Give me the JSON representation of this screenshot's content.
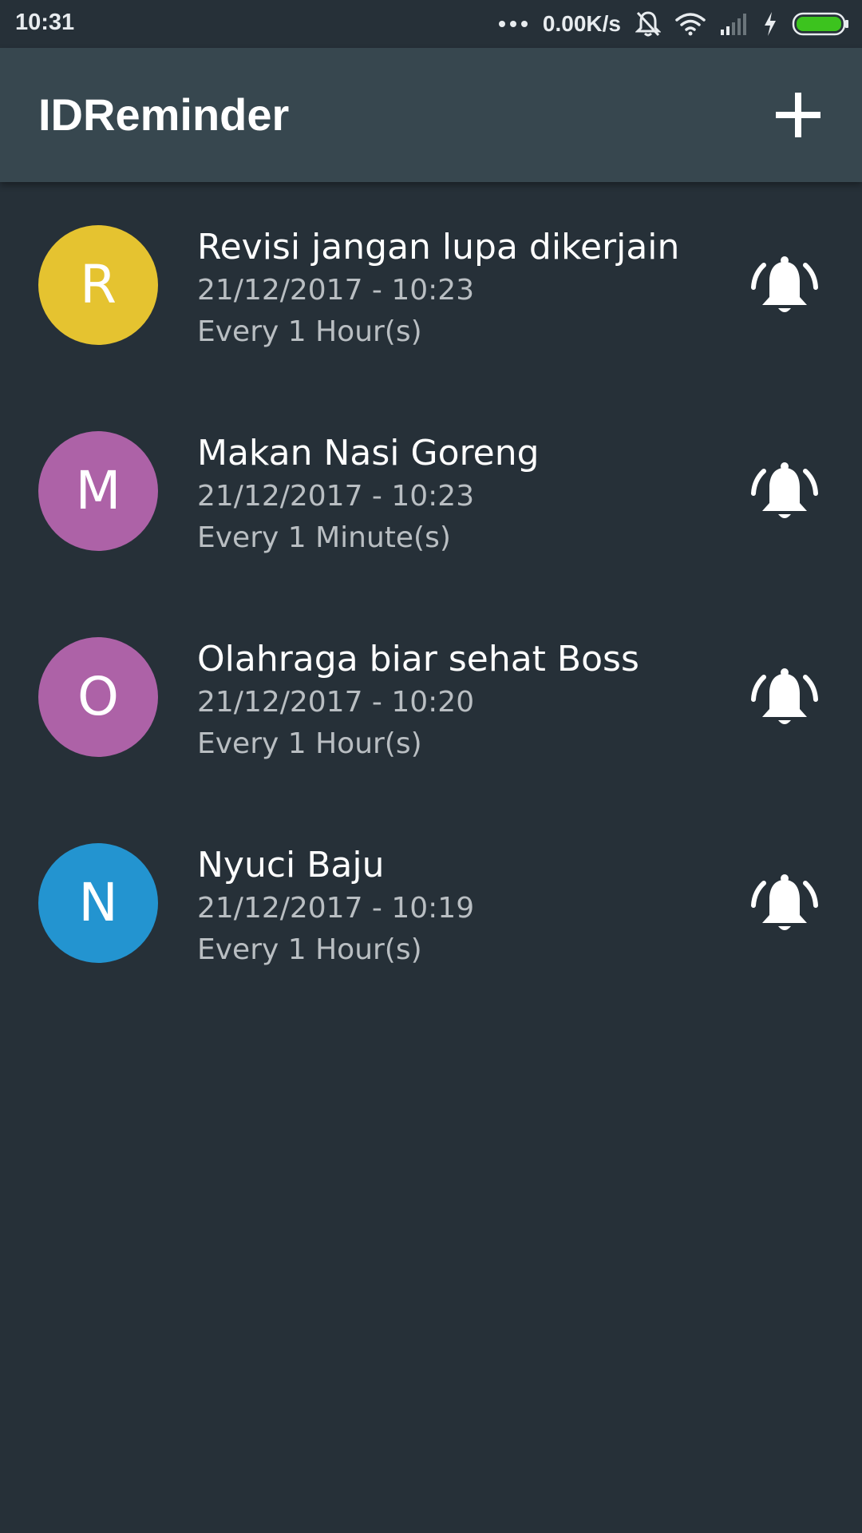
{
  "status_bar": {
    "time": "10:31",
    "dots": "...",
    "net_speed": "0.00K/s",
    "icons": [
      "mute-bell-icon",
      "wifi-icon",
      "signal-icon",
      "charging-icon",
      "battery-icon"
    ]
  },
  "app_bar": {
    "title": "IDReminder",
    "add_icon": "plus-icon"
  },
  "colors": {
    "background": "#263038",
    "app_bar": "#37474f",
    "secondary_text": "#b9bec2",
    "battery": "#3cc31e"
  },
  "reminders": [
    {
      "letter": "R",
      "avatar_color": "#e5c330",
      "title": "Revisi jangan lupa dikerjain",
      "datetime": "21/12/2017 - 10:23",
      "repeat": "Every 1 Hour(s)",
      "alarm_icon": "alarm-bell-icon"
    },
    {
      "letter": "M",
      "avatar_color": "#ad62a7",
      "title": "Makan Nasi Goreng",
      "datetime": "21/12/2017 - 10:23",
      "repeat": "Every 1 Minute(s)",
      "alarm_icon": "alarm-bell-icon"
    },
    {
      "letter": "O",
      "avatar_color": "#ad62a7",
      "title": "Olahraga biar sehat Boss",
      "datetime": "21/12/2017 - 10:20",
      "repeat": "Every 1 Hour(s)",
      "alarm_icon": "alarm-bell-icon"
    },
    {
      "letter": "N",
      "avatar_color": "#2394d0",
      "title": "Nyuci Baju",
      "datetime": "21/12/2017 - 10:19",
      "repeat": "Every 1 Hour(s)",
      "alarm_icon": "alarm-bell-icon"
    }
  ]
}
